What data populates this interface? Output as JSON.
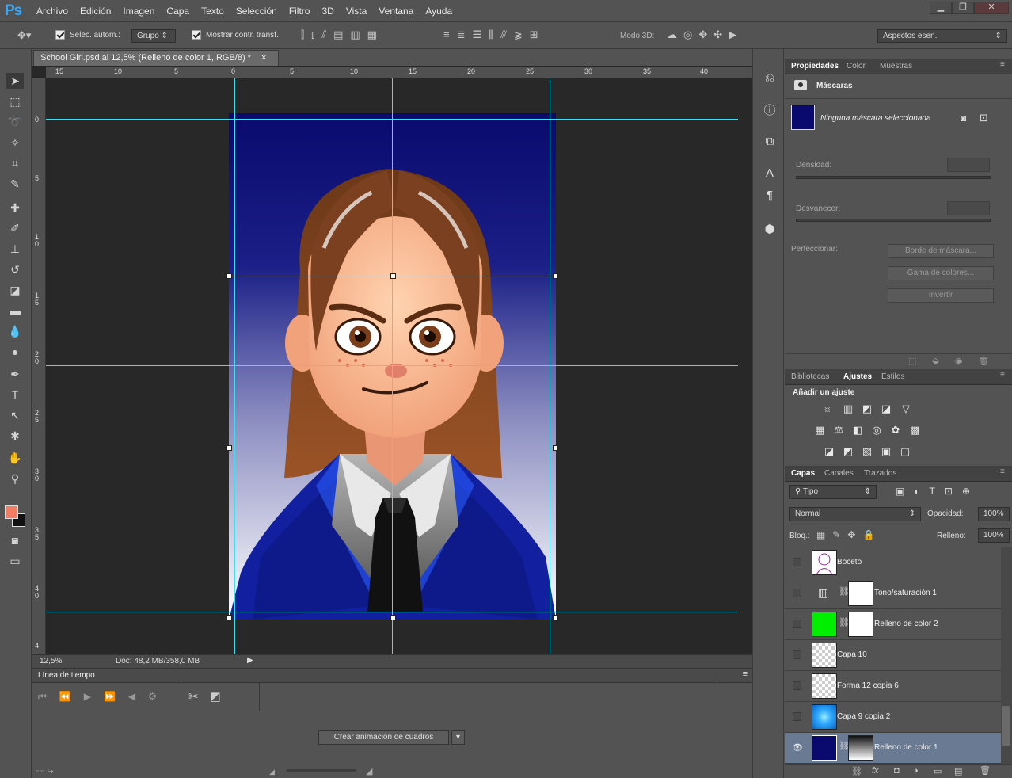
{
  "app": {
    "logo": "Ps"
  },
  "menu": [
    "Archivo",
    "Edición",
    "Imagen",
    "Capa",
    "Texto",
    "Selección",
    "Filtro",
    "3D",
    "Vista",
    "Ventana",
    "Ayuda"
  ],
  "window_controls": {
    "minimize": "▁",
    "restore": "❐",
    "close": "✕"
  },
  "options": {
    "auto_select_label": "Selec. autom.:",
    "auto_select_value": "Grupo",
    "show_transform_label": "Mostrar contr. transf.",
    "mode3d_label": "Modo 3D:",
    "workspace_value": "Aspectos esen."
  },
  "document": {
    "tab_title": "School Girl.psd al 12,5% (Relleno de color 1, RGB/8) *",
    "close": "×"
  },
  "rulers": {
    "h": [
      "15",
      "10",
      "5",
      "0",
      "5",
      "10",
      "15",
      "20",
      "25",
      "30",
      "35",
      "40"
    ],
    "v": [
      "0",
      "5",
      "1\n0",
      "1\n5",
      "2\n0",
      "2\n5",
      "3\n0",
      "3\n5",
      "4\n0",
      "4"
    ]
  },
  "status": {
    "zoom": "12,5%",
    "doc": "Doc: 48,2 MB/358,0 MB"
  },
  "timeline": {
    "title": "Línea de tiempo",
    "create_button": "Crear animación de cuadros"
  },
  "properties": {
    "tabs": [
      "Propiedades",
      "Color",
      "Muestras"
    ],
    "active_tab": "Propiedades",
    "section": "Máscaras",
    "mask_status": "Ninguna máscara seleccionada",
    "density_label": "Densidad:",
    "feather_label": "Desvanecer:",
    "refine_label": "Perfeccionar:",
    "mask_edge_button": "Borde de máscara...",
    "color_range_button": "Gama de colores...",
    "invert_button": "Invertir"
  },
  "adjustments": {
    "tabs": [
      "Bibliotecas",
      "Ajustes",
      "Estilos"
    ],
    "active_tab": "Ajustes",
    "title": "Añadir un ajuste",
    "row1": [
      "☼",
      "▥",
      "◩",
      "◪",
      "▽"
    ],
    "row2": [
      "▦",
      "⚖",
      "◧",
      "◎",
      "✿",
      "▩"
    ],
    "row3": [
      "◪",
      "◩",
      "▧",
      "▣",
      "▢"
    ]
  },
  "layers_panel": {
    "tabs": [
      "Capas",
      "Canales",
      "Trazados"
    ],
    "active_tab": "Capas",
    "filter": "Tipo",
    "blend_mode": "Normal",
    "opacity_label": "Opacidad:",
    "opacity_value": "100%",
    "lock_label": "Bloq.:",
    "fill_label": "Relleno:",
    "fill_value": "100%",
    "layers": [
      {
        "name": "Boceto",
        "visible": false,
        "selected": false
      },
      {
        "name": "Tono/saturación 1",
        "visible": false,
        "selected": false
      },
      {
        "name": "Relleno de color 2",
        "visible": false,
        "selected": false
      },
      {
        "name": "Capa 10",
        "visible": false,
        "selected": false
      },
      {
        "name": "Forma 12 copia 6",
        "visible": false,
        "selected": false
      },
      {
        "name": "Capa 9 copia 2",
        "visible": false,
        "selected": false
      },
      {
        "name": "Relleno de color 1",
        "visible": true,
        "selected": true
      }
    ],
    "footer_icons": [
      "⛓",
      "fx",
      "◘",
      "◑",
      "▭",
      "▤",
      "🗑"
    ]
  },
  "colors": {
    "foreground": "#f47b64",
    "background": "#111111",
    "canvas_fill": "#0a0a6e"
  }
}
